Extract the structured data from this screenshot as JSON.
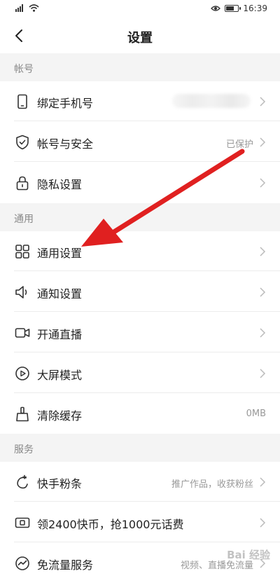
{
  "status_bar": {
    "signal_text": "4G",
    "time": "16:39",
    "battery_level": 0.75,
    "icons": [
      "signal-icon",
      "wifi-icon",
      "eye-icon",
      "battery-icon"
    ]
  },
  "header": {
    "title": "设置",
    "back_icon": "back-arrow-icon"
  },
  "sections": {
    "account": {
      "title": "帐号",
      "items": [
        {
          "label": "绑定手机号",
          "value": "",
          "icon": "phone-icon"
        },
        {
          "label": "帐号与安全",
          "value": "已保护",
          "icon": "shield-icon"
        },
        {
          "label": "隐私设置",
          "value": "",
          "icon": "lock-icon"
        }
      ]
    },
    "general": {
      "title": "通用",
      "items": [
        {
          "label": "通用设置",
          "value": "",
          "icon": "grid-icon"
        },
        {
          "label": "通知设置",
          "value": "",
          "icon": "speaker-icon"
        },
        {
          "label": "开通直播",
          "value": "",
          "icon": "camera-icon"
        },
        {
          "label": "大屏模式",
          "value": "",
          "icon": "play-icon"
        },
        {
          "label": "清除缓存",
          "value": "0MB",
          "icon": "broom-icon"
        }
      ]
    },
    "service": {
      "title": "服务",
      "items": [
        {
          "label": "快手粉条",
          "value": "推广作品，收获粉丝",
          "icon": "sprout-icon"
        },
        {
          "label": "领2400快币，抢1000元话费",
          "value": "",
          "icon": "coin-card-icon"
        },
        {
          "label": "免流量服务",
          "value": "视频、直播免流量",
          "icon": "speed-icon"
        }
      ]
    }
  },
  "annotation": {
    "color": "#e02020"
  },
  "watermark": {
    "text": "Bai 经验"
  },
  "colors": {
    "section_bg": "#f4f4f4",
    "value_text": "#999999"
  }
}
